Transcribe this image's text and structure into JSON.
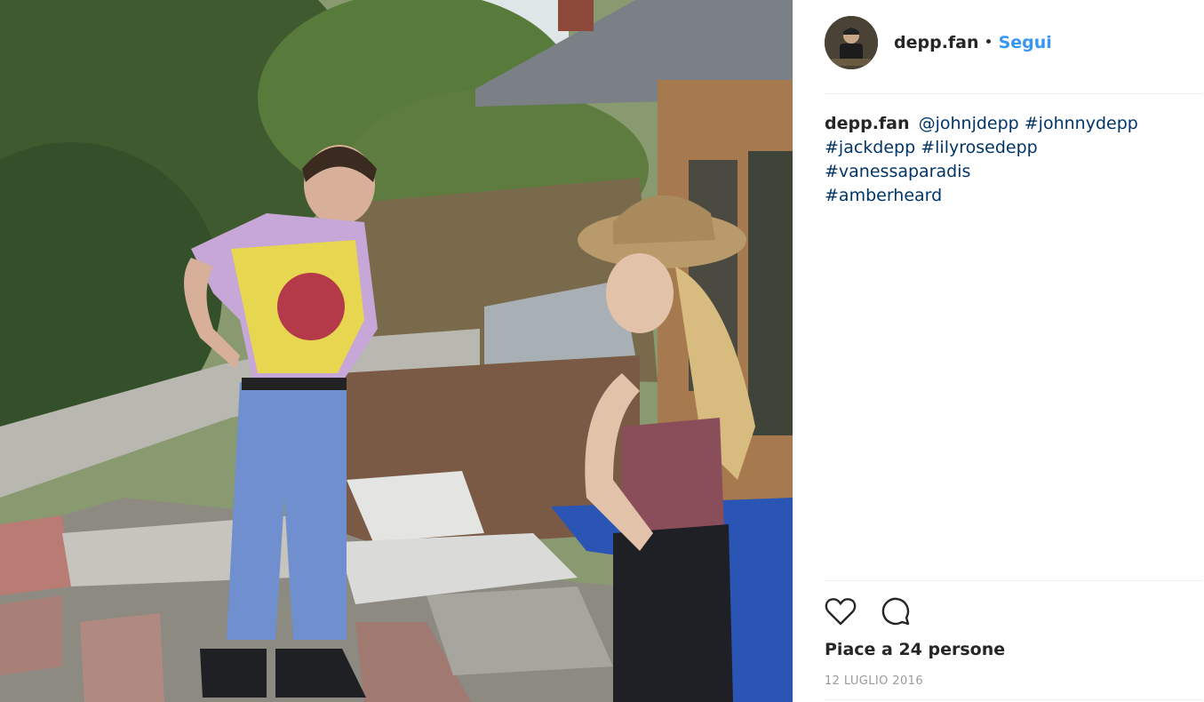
{
  "post": {
    "username": "depp.fan",
    "separator": "•",
    "follow_label": "Segui",
    "caption": {
      "username": "depp.fan",
      "parts": [
        "@johnjdepp",
        "#johnnydepp",
        "#jackdepp",
        "#lilyrosedepp",
        "#vanessaparadis",
        "#amberheard"
      ]
    },
    "likes_text": "Piace a 24 persone",
    "date": "12 LUGLIO 2016"
  },
  "icons": {
    "like": "heart-icon",
    "comment": "comment-icon"
  },
  "colors": {
    "link": "#003569",
    "follow": "#3897f0",
    "text": "#262626",
    "muted": "#999999"
  }
}
